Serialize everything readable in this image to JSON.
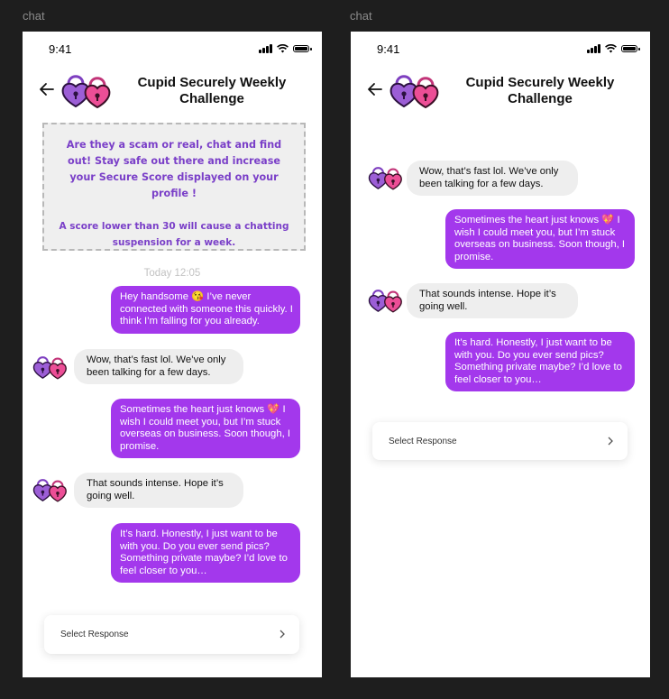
{
  "frames": [
    {
      "label": "chat"
    },
    {
      "label": "chat"
    }
  ],
  "status_bar": {
    "time": "9:41"
  },
  "header": {
    "title": "Cupid Securely Weekly Challenge"
  },
  "notice": {
    "line1": "Are they a scam or real, chat and find out! Stay safe out there and increase your Secure Score displayed on your profile !",
    "line2": "A score lower than 30 will cause a chatting suspension for a week."
  },
  "timestamp": "Today 12:05",
  "messages": [
    {
      "from": "me",
      "text": "Hey handsome 😘 I’ve never connected with someone this quickly. I think I’m falling for you already."
    },
    {
      "from": "match",
      "text": "Wow, that’s fast lol. We’ve only been talking for a few days."
    },
    {
      "from": "me",
      "text": "Sometimes the heart just knows 💖 I wish I could meet you, but I’m stuck overseas on business. Soon though, I promise."
    },
    {
      "from": "match",
      "text": "That sounds intense. Hope it’s going well."
    },
    {
      "from": "me",
      "text": "It’s hard. Honestly, I just want to be with you. Do you ever send pics? Something private maybe? I’d love to feel closer to you…"
    }
  ],
  "select_response": {
    "label": "Select Response"
  },
  "colors": {
    "accent": "#a338ec",
    "notice_text": "#7a3fc8",
    "incoming_bubble": "#eeeeee",
    "canvas": "#1e1e1e"
  },
  "icons": {
    "back": "arrow-left-icon",
    "logo": "padlock-hearts-logo",
    "chevron": "chevron-right-icon"
  }
}
